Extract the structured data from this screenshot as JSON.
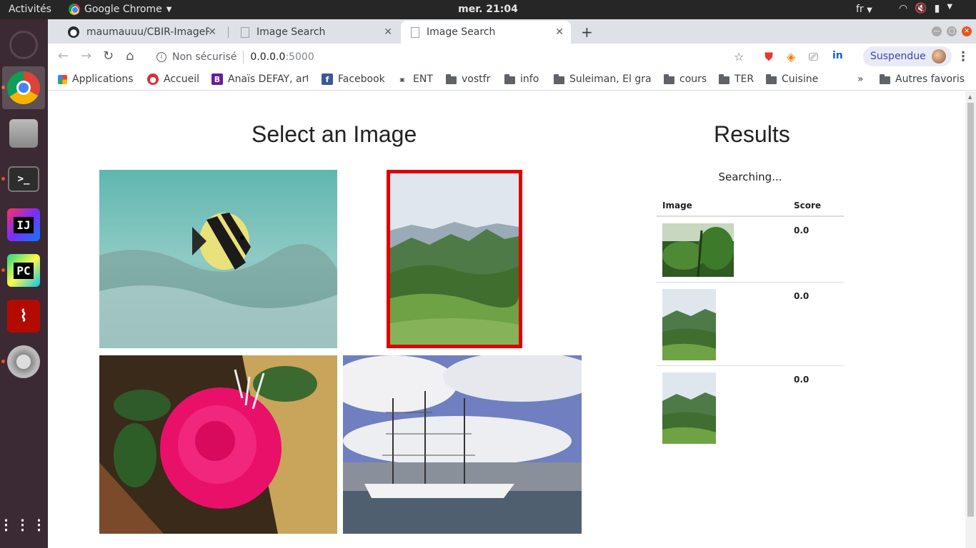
{
  "system": {
    "activities": "Activités",
    "app_name": "Google Chrome",
    "clock": "mer. 21:04",
    "lang": "fr"
  },
  "tabs": [
    {
      "title": "maumauuu/CBIR-ImageR",
      "icon": "github-icon"
    },
    {
      "title": "Image Search",
      "icon": "page-icon"
    },
    {
      "title": "Image Search",
      "icon": "page-icon",
      "active": true
    }
  ],
  "address": {
    "security": "Non sécurisé",
    "host": "0.0.0.0",
    "port": ":5000"
  },
  "profile": {
    "label": "Suspendue"
  },
  "bookmarks": [
    {
      "label": "Applications",
      "icon": "apps-grid-icon"
    },
    {
      "label": "Accueil",
      "icon": "accueil-icon"
    },
    {
      "label": "Anaïs DEFAY, art",
      "icon": "b-icon"
    },
    {
      "label": "Facebook",
      "icon": "facebook-icon"
    },
    {
      "label": "ENT",
      "icon": "ent-icon"
    },
    {
      "label": "vostfr",
      "icon": "folder-icon"
    },
    {
      "label": "info",
      "icon": "folder-icon"
    },
    {
      "label": "Suleiman, El gran",
      "icon": "folder-icon"
    },
    {
      "label": "cours",
      "icon": "folder-icon"
    },
    {
      "label": "TER",
      "icon": "folder-icon"
    },
    {
      "label": "Cuisine",
      "icon": "folder-icon"
    }
  ],
  "bookmarks_overflow": "»",
  "other_bookmarks": "Autres favoris",
  "page": {
    "select_title": "Select an Image",
    "results_title": "Results",
    "status": "Searching...",
    "table": {
      "headers": [
        "Image",
        "Score"
      ],
      "rows": [
        {
          "image": "jungle-leaves-photo",
          "score": "0.0"
        },
        {
          "image": "mountain-landscape-photo",
          "score": "0.0"
        },
        {
          "image": "mountain-landscape-photo",
          "score": "0.0"
        }
      ]
    },
    "gallery": [
      {
        "name": "fish-underwater-photo"
      },
      {
        "name": "mountain-landscape-photo",
        "selected": true
      },
      {
        "name": "pink-rose-photo"
      },
      {
        "name": "tall-ship-harbor-photo"
      }
    ]
  },
  "colors": {
    "selection_border": "#e00000",
    "dock_background": "#3b2a33",
    "topbar_background": "#262626",
    "profile_text": "#3949ab"
  }
}
